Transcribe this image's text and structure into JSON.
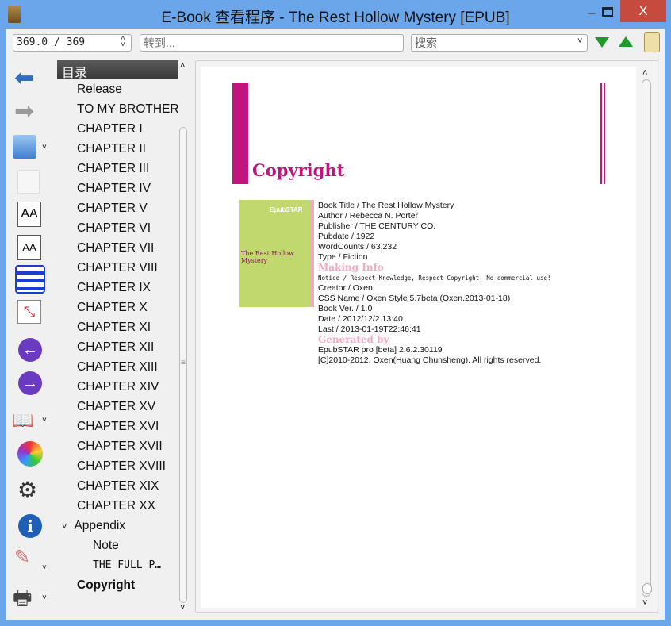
{
  "window": {
    "title": "E-Book 查看程序 - The Rest Hollow Mystery [EPUB]",
    "min": "–",
    "close": "X"
  },
  "toolbar": {
    "page_value": "369.0 / 369",
    "goto_placeholder": "转到...",
    "search_placeholder": "搜索"
  },
  "toc": {
    "header": "目录",
    "items": [
      "Release",
      "TO MY BROTHER",
      "CHAPTER I",
      "CHAPTER II",
      "CHAPTER III",
      "CHAPTER IV",
      "CHAPTER V",
      "CHAPTER VI",
      "CHAPTER VII",
      "CHAPTER VIII",
      "CHAPTER IX",
      "CHAPTER X",
      "CHAPTER XI",
      "CHAPTER XII",
      "CHAPTER XIII",
      "CHAPTER XIV",
      "CHAPTER XV",
      "CHAPTER XVI",
      "CHAPTER XVII",
      "CHAPTER XVIII",
      "CHAPTER XIX",
      "CHAPTER XX"
    ],
    "appendix": "Appendix",
    "sub": [
      "Note",
      "THE FULL P…"
    ],
    "current": "Copyright"
  },
  "content": {
    "heading": "Copyright",
    "cover": {
      "brand": "EpubSTAR",
      "title": "The Rest Hollow Mystery"
    },
    "book_info": [
      "Book Title / The Rest Hollow Mystery",
      "Author / Rebecca N. Porter",
      "Publisher / THE CENTURY CO.",
      "Pubdate / 1922",
      "WordCounts / 63,232",
      "Type / Fiction"
    ],
    "making_heading": "Making Info",
    "notice": "Notice / Respect Knowledge, Respect Copyright. No commercial use!",
    "making_info": [
      "Creator / Oxen",
      "CSS Name / Oxen Style 5.7beta (Oxen,2013-01-18)",
      "Book Ver. / 1.0",
      "Date / 2012/12/2 13:40",
      "Last / 2013-01-19T22:46:41"
    ],
    "generated_heading": "Generated by",
    "generated": [
      "EpubSTAR pro [beta] 2.6.2.30119",
      "[C]2010-2012, Oxen(Huang Chunsheng). All rights reserved."
    ]
  },
  "colors": {
    "accent": "#c0157f",
    "pink": "#f4a9c4",
    "cover": "#c1d86e"
  }
}
